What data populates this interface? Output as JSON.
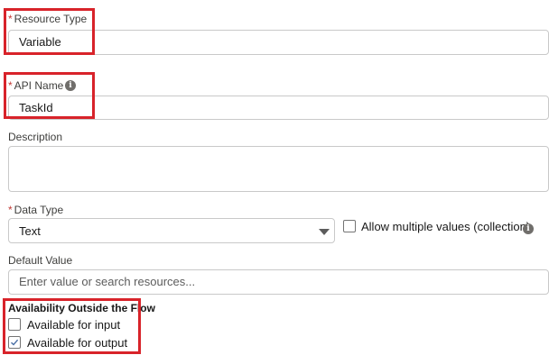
{
  "resource_type": {
    "label": "Resource Type",
    "value": "Variable"
  },
  "api_name": {
    "label": "API Name",
    "value": "TaskId",
    "info_icon": "info-icon"
  },
  "description": {
    "label": "Description",
    "value": ""
  },
  "data_type": {
    "label": "Data Type",
    "value": "Text",
    "collection_label": "Allow multiple values (collection)",
    "collection_checked": false
  },
  "default_value": {
    "label": "Default Value",
    "placeholder": "Enter value or search resources..."
  },
  "availability": {
    "title": "Availability Outside the Flow",
    "input_label": "Available for input",
    "input_checked": false,
    "output_label": "Available for output",
    "output_checked": true
  },
  "required_marker": "*",
  "colors": {
    "highlight": "#d8232a",
    "required": "#c23934",
    "border": "#c9c9c9"
  }
}
